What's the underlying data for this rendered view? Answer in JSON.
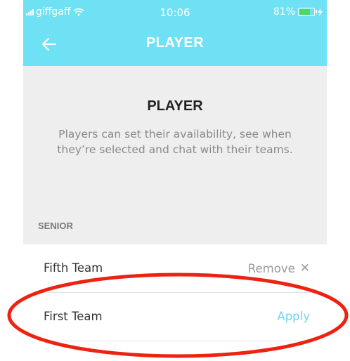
{
  "status_bar": {
    "carrier": "giffgaff",
    "time": "10:06",
    "battery_percent": "81%",
    "battery_level": 0.81,
    "battery_color": "#4cd964"
  },
  "header": {
    "title": "PLAYER",
    "back_icon": "arrow-left-icon",
    "background": "#6fe1f5"
  },
  "intro": {
    "title": "PLAYER",
    "description": "Players can set their availability, see when they’re selected and chat with their teams.",
    "section_label": "SENIOR"
  },
  "teams": [
    {
      "name": "Fifth Team",
      "action": "Remove",
      "action_icon": "close-icon"
    },
    {
      "name": "First Team",
      "action": "Apply"
    }
  ],
  "colors": {
    "accent": "#6ed6f0",
    "annotation": "#ee2211"
  }
}
